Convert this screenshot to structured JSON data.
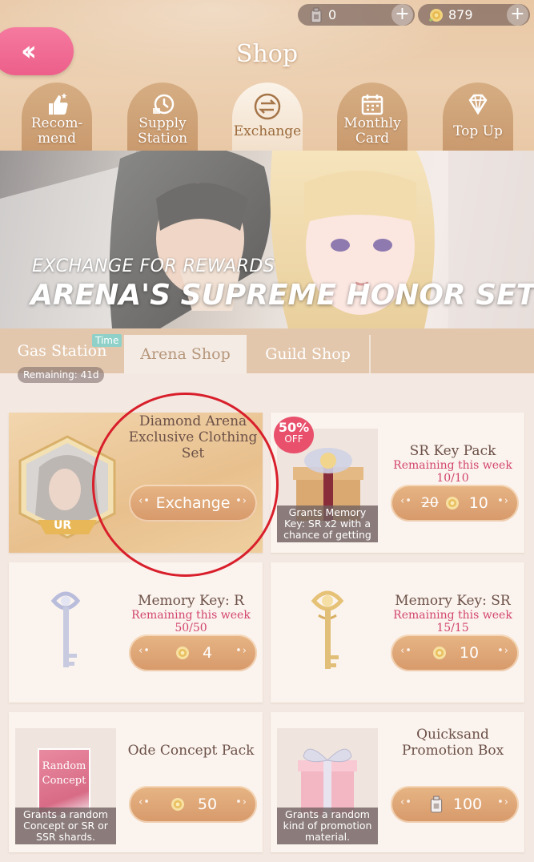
{
  "header": {
    "title": "Shop",
    "currencies": [
      {
        "icon": "gas-canister-icon",
        "value": "0"
      },
      {
        "icon": "rose-icon",
        "value": "879"
      }
    ]
  },
  "tabs": [
    {
      "label": "Recom-\nmend",
      "icon": "thumbs-up-icon"
    },
    {
      "label": "Supply\nStation",
      "icon": "clock-icon"
    },
    {
      "label": "Exchange",
      "icon": "exchange-icon",
      "active": true
    },
    {
      "label": "Monthly\nCard",
      "icon": "calendar-icon"
    },
    {
      "label": "Top Up",
      "icon": "diamond-icon"
    }
  ],
  "banner": {
    "subtitle": "EXCHANGE FOR REWARDS",
    "title": "ARENA'S SUPREME HONOR SET"
  },
  "subtabs": {
    "items": [
      "Gas Station",
      "Arena Shop",
      "Guild Shop"
    ],
    "active": "Arena Shop",
    "time_tag": "Time",
    "remaining": "Remaining: 41d"
  },
  "items": {
    "featured": {
      "name": "Diamond Arena Exclusive Clothing Set",
      "badge": "UR",
      "button": "Exchange"
    },
    "sr_key_pack": {
      "name": "SR Key Pack",
      "remaining_label": "Remaining this week",
      "remaining_count": "10/10",
      "description": "Grants Memory Key: SR x2 with a chance of getting",
      "discount_pct": "50%",
      "discount_off": "OFF",
      "old_price": "20",
      "price": "10"
    },
    "memory_key_r": {
      "name": "Memory Key: R",
      "remaining_label": "Remaining this week",
      "remaining_count": "50/50",
      "price": "4"
    },
    "memory_key_sr": {
      "name": "Memory Key: SR",
      "remaining_label": "Remaining this week",
      "remaining_count": "15/15",
      "price": "10"
    },
    "ode_concept_pack": {
      "name": "Ode Concept Pack",
      "thumb_label": "Random Concept",
      "description": "Grants a random Concept or SR or SSR shards.",
      "price": "50"
    },
    "quicksand_box": {
      "name": "Quicksand Promotion Box",
      "description": "Grants a random kind of promotion material.",
      "price": "100"
    }
  },
  "colors": {
    "accent_pink": "#ec5f8a",
    "remaining_red": "#d2456e",
    "button_gold": "#d7996a",
    "highlight_circle": "#d81f2b"
  }
}
